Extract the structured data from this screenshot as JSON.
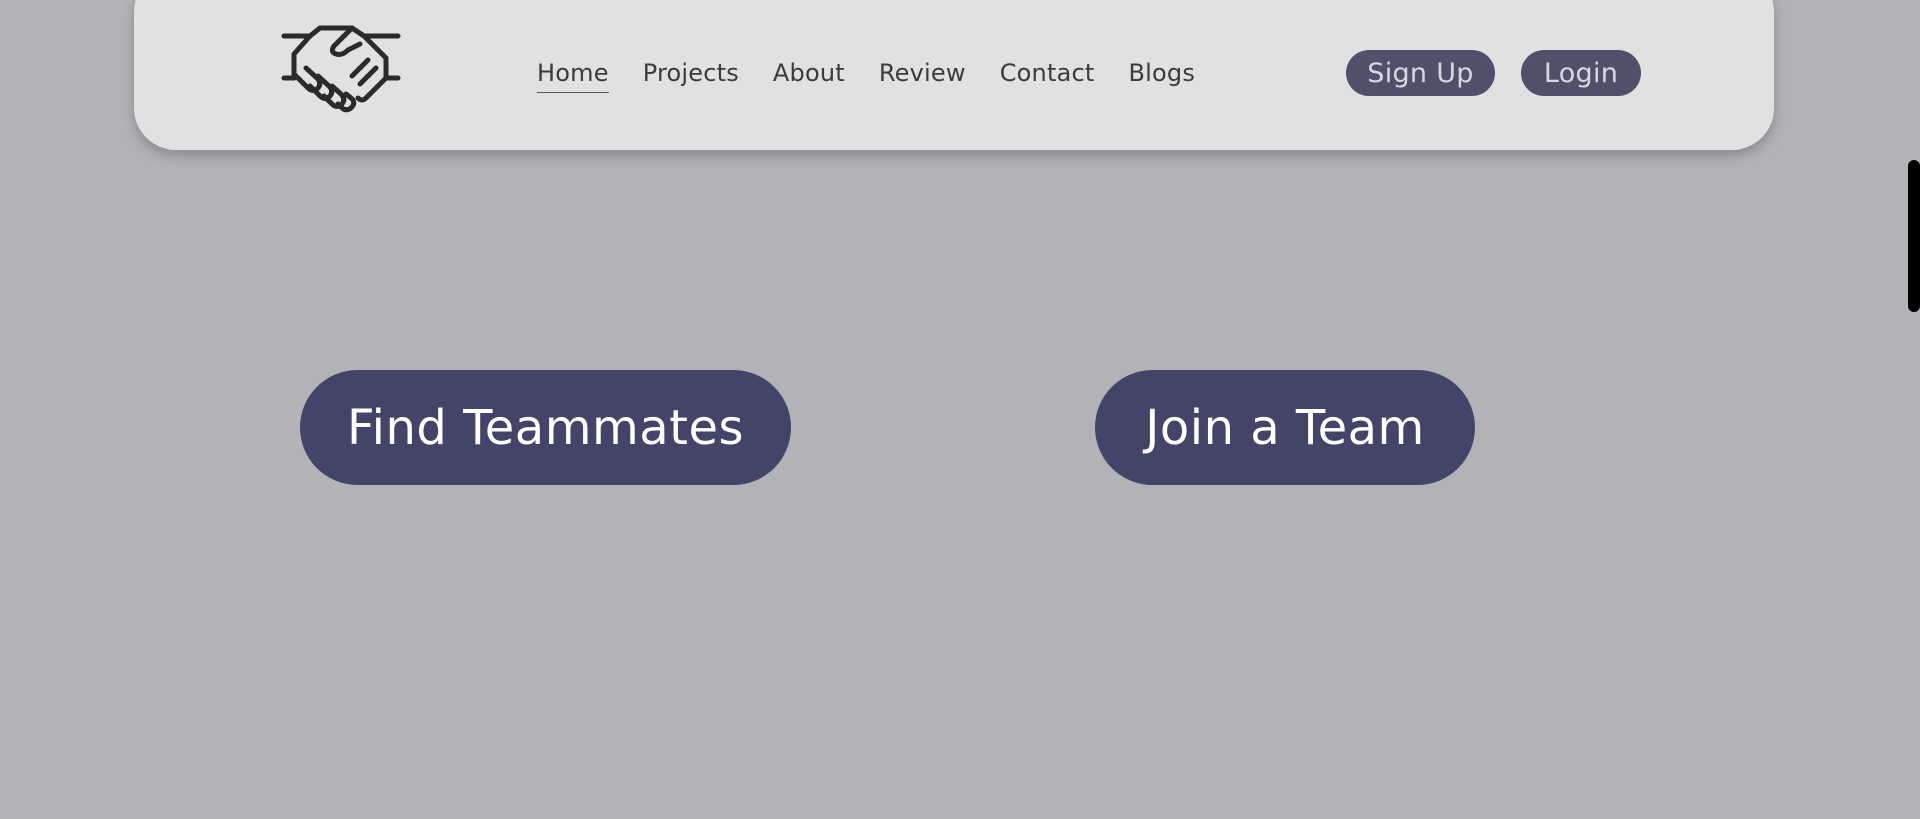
{
  "header": {
    "logo_icon": "handshake-icon",
    "nav": [
      {
        "label": "Home",
        "active": true
      },
      {
        "label": "Projects",
        "active": false
      },
      {
        "label": "About",
        "active": false
      },
      {
        "label": "Review",
        "active": false
      },
      {
        "label": "Contact",
        "active": false
      },
      {
        "label": "Blogs",
        "active": false
      }
    ],
    "signup_label": "Sign Up",
    "login_label": "Login"
  },
  "hero": {
    "find_label": "Find Teammates",
    "join_label": "Join a Team"
  },
  "colors": {
    "page_bg": "#b3b2b7",
    "navbar_bg": "#e1e1e1",
    "auth_button": "#50506b",
    "cta_button": "#424468",
    "scrollbar_thumb": "#000000"
  }
}
